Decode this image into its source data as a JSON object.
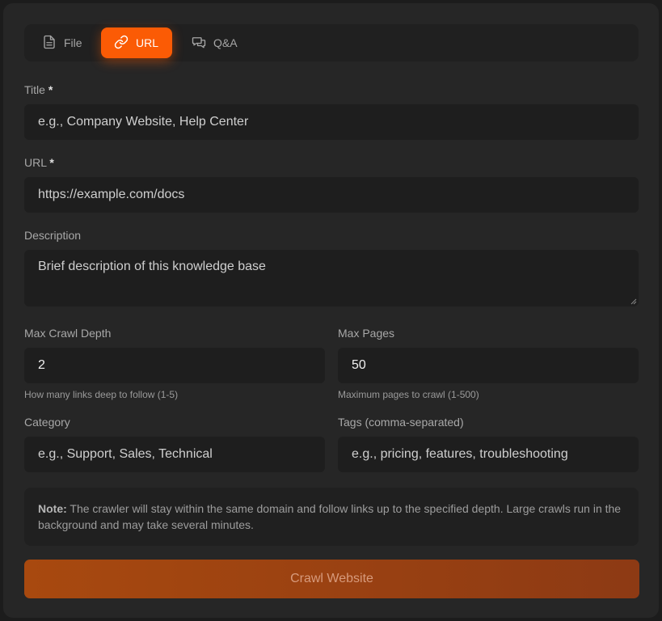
{
  "tabs": [
    {
      "label": "File",
      "icon": "file-icon"
    },
    {
      "label": "URL",
      "icon": "link-icon"
    },
    {
      "label": "Q&A",
      "icon": "chat-bubbles-icon"
    }
  ],
  "active_tab": "URL",
  "accent_color": "#fb5b05",
  "form": {
    "title": {
      "label": "Title",
      "required_mark": "*",
      "placeholder": "e.g., Company Website, Help Center"
    },
    "url": {
      "label": "URL",
      "required_mark": "*",
      "placeholder": "https://example.com/docs"
    },
    "description": {
      "label": "Description",
      "placeholder": "Brief description of this knowledge base"
    },
    "max_crawl_depth": {
      "label": "Max Crawl Depth",
      "value": "2",
      "hint": "How many links deep to follow (1-5)"
    },
    "max_pages": {
      "label": "Max Pages",
      "value": "50",
      "hint": "Maximum pages to crawl (1-500)"
    },
    "category": {
      "label": "Category",
      "placeholder": "e.g., Support, Sales, Technical"
    },
    "tags": {
      "label": "Tags (comma-separated)",
      "placeholder": "e.g., pricing, features, troubleshooting"
    }
  },
  "note": {
    "label": "Note:",
    "text": "The crawler will stay within the same domain and follow links up to the specified depth. Large crawls run in the background and may take several minutes."
  },
  "submit_label": "Crawl Website"
}
